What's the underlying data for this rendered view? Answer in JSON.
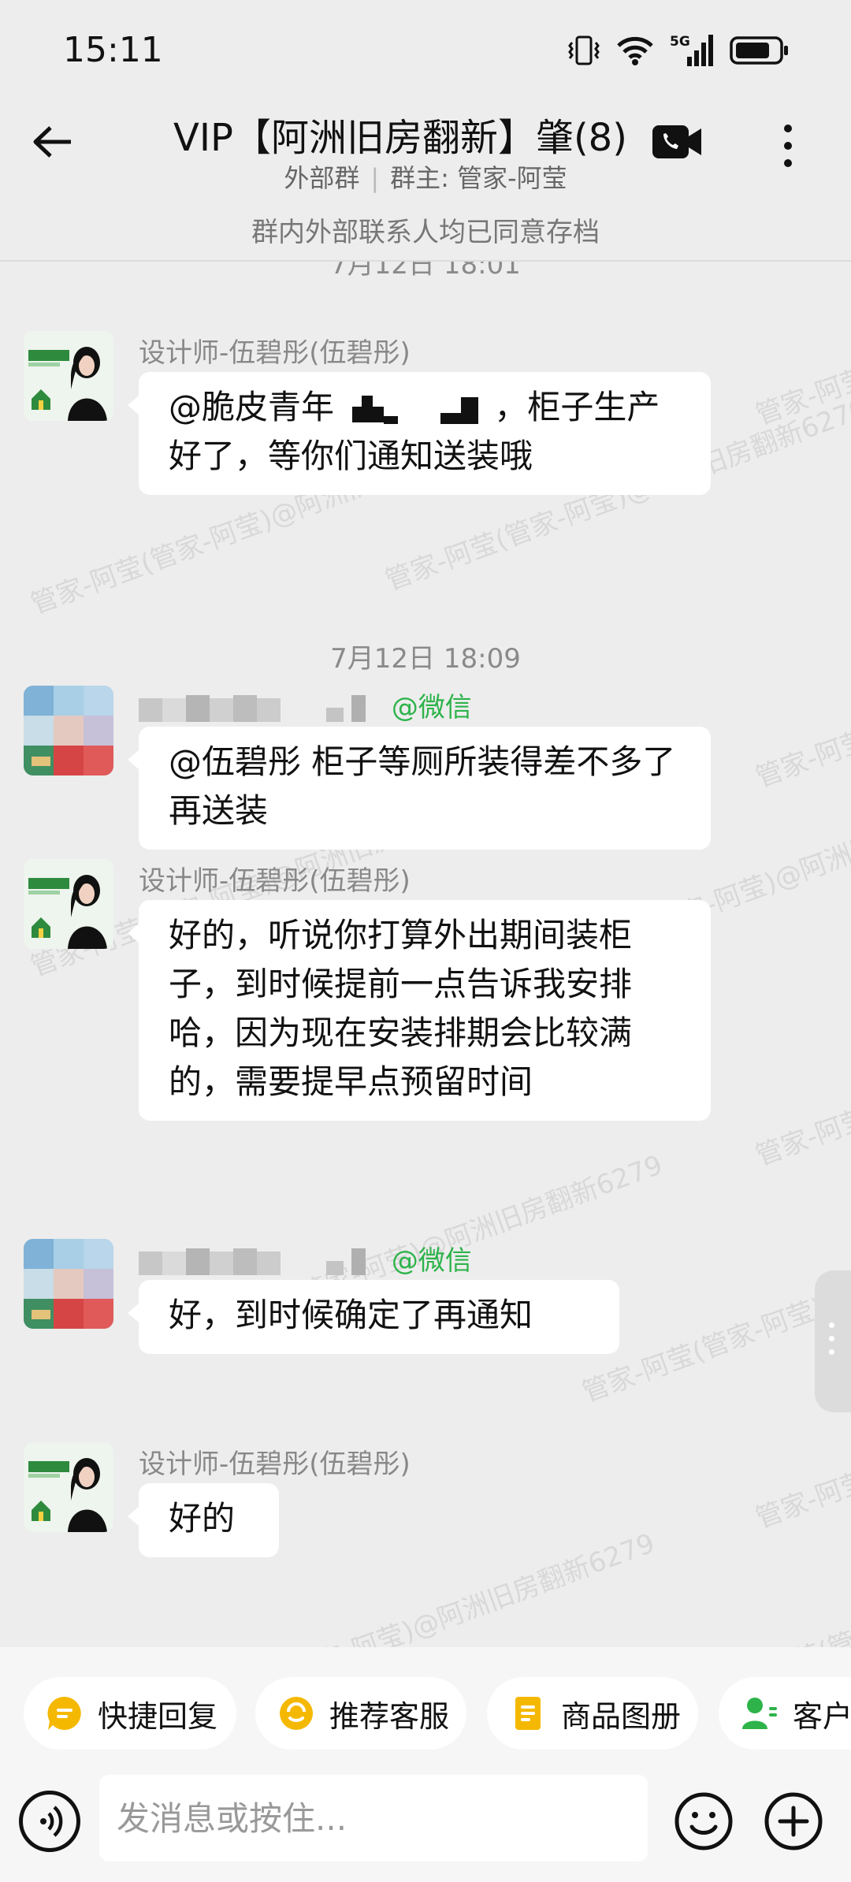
{
  "status": {
    "time": "15:11",
    "network": "5G"
  },
  "header": {
    "title": "VIP【阿洲旧房翻新】肇(8)",
    "subtitle_left": "外部群",
    "subtitle_right": "群主: 管家-阿莹"
  },
  "notice": "群内外部联系人均已同意存档",
  "watermark": "管家-阿莹(管家-阿莹)@阿洲旧房翻新6279",
  "messages": [
    {
      "timestamp_cut": "7月12日  18:01"
    },
    {
      "sender": "设计师-伍碧彤(伍碧彤)",
      "text_prefix": "@脆皮青年",
      "text_suffix": "，柜子生产好了，等你们通知送装哦"
    },
    {
      "timestamp": "7月12日  18:09"
    },
    {
      "sender_tag": "@微信",
      "text": "@伍碧彤 柜子等厕所装得差不多了再送装"
    },
    {
      "sender": "设计师-伍碧彤(伍碧彤)",
      "text": "好的，听说你打算外出期间装柜子，到时候提前一点告诉我安排哈，因为现在安装排期会比较满的，需要提早点预留时间"
    },
    {
      "sender_tag": "@微信",
      "text": "好，到时候确定了再通知"
    },
    {
      "sender": "设计师-伍碧彤(伍碧彤)",
      "text": "好的"
    }
  ],
  "quick_actions": [
    "快捷回复",
    "推荐客服",
    "商品图册",
    "客户"
  ],
  "input": {
    "placeholder": "发消息或按住..."
  },
  "colors": {
    "background": "#EDEDED",
    "bubble": "#FFFFFF",
    "wechat_tag": "#2DB34A",
    "accent_yellow": "#F5B800",
    "accent_green": "#2DB34A"
  }
}
